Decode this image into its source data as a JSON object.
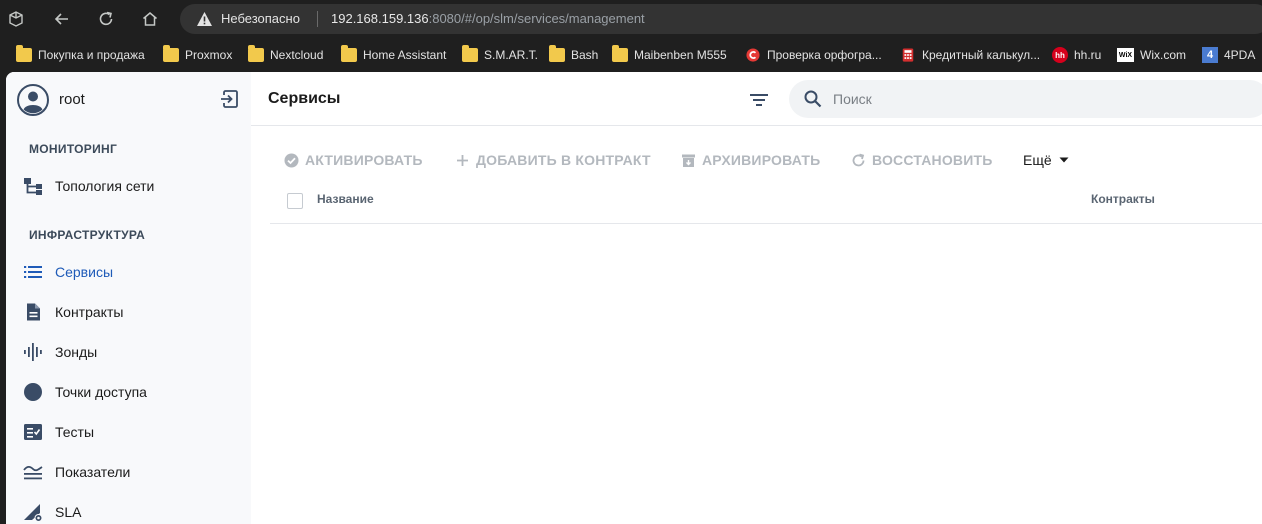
{
  "browser": {
    "security_label": "Небезопасно",
    "url_host": "192.168.159.136",
    "url_rest": ":8080/#/op/slm/services/management"
  },
  "bookmarks": [
    {
      "label": "Покупка и продажа",
      "icon": "folder-icon"
    },
    {
      "label": "Proxmox",
      "icon": "folder-icon"
    },
    {
      "label": "Nextcloud",
      "icon": "folder-icon"
    },
    {
      "label": "Home Assistant",
      "icon": "folder-icon"
    },
    {
      "label": "S.M.AR.T.",
      "icon": "folder-icon"
    },
    {
      "label": "Bash",
      "icon": "folder-icon"
    },
    {
      "label": "Maibenben M555",
      "icon": "folder-icon"
    },
    {
      "label": "Проверка орфогра...",
      "icon": "spellcheck-icon"
    },
    {
      "label": "Кредитный калькул...",
      "icon": "calculator-icon"
    },
    {
      "label": "hh.ru",
      "icon": "hh-icon",
      "icon_text": "hh"
    },
    {
      "label": "Wix.com",
      "icon": "wix-icon",
      "icon_text": "WiX"
    },
    {
      "label": "4PDA",
      "icon": "4pda-icon",
      "icon_text": "4"
    }
  ],
  "user": {
    "name": "root"
  },
  "sidebar": {
    "sections": [
      {
        "title": "МОНИТОРИНГ"
      },
      {
        "title": "ИНФРАСТРУКТУРА"
      }
    ],
    "items": [
      {
        "label": "Топология сети",
        "icon": "topology-icon"
      },
      {
        "label": "Сервисы",
        "icon": "list-icon",
        "active": true
      },
      {
        "label": "Контракты",
        "icon": "document-icon"
      },
      {
        "label": "Зонды",
        "icon": "probe-icon"
      },
      {
        "label": "Точки доступа",
        "icon": "circle-icon"
      },
      {
        "label": "Тесты",
        "icon": "checklist-icon"
      },
      {
        "label": "Показатели",
        "icon": "metrics-icon"
      },
      {
        "label": "SLA",
        "icon": "sla-icon"
      }
    ]
  },
  "header": {
    "title": "Сервисы",
    "search_placeholder": "Поиск"
  },
  "toolbar": {
    "activate": "АКТИВИРОВАТЬ",
    "add_to_contract": "ДОБАВИТЬ В КОНТРАКТ",
    "archive": "АРХИВИРОВАТЬ",
    "restore": "ВОССТАНОВИТЬ",
    "more": "Ещё"
  },
  "table": {
    "columns": [
      "Название",
      "Контракты"
    ]
  },
  "colors": {
    "accent": "#1f5bb8",
    "disabled": "#b3b8be",
    "sidebar_bg": "#f8f9fb"
  }
}
